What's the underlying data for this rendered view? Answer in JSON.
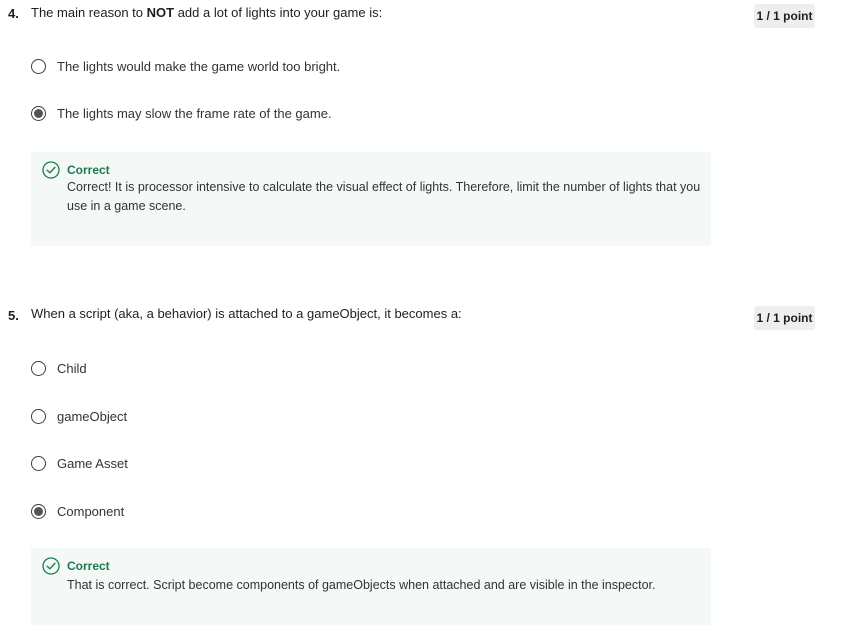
{
  "q4": {
    "number": "4.",
    "text_pre": "The main reason to ",
    "text_bold": "NOT",
    "text_post": " add a lot of lights into your game is:",
    "points": "1 / 1 point",
    "options": [
      {
        "label": "The lights would make the game world too bright.",
        "selected": false
      },
      {
        "label": "The lights may slow the frame rate of the game.",
        "selected": true
      }
    ],
    "feedback": {
      "status": "Correct",
      "text": "Correct! It is processor intensive to calculate the visual effect of lights.  Therefore, limit the number of lights that you use in a game scene."
    }
  },
  "q5": {
    "number": "5.",
    "text": "When a script (aka, a behavior) is attached to a gameObject, it becomes a:",
    "points": "1 / 1 point",
    "options": [
      {
        "label": "Child",
        "selected": false
      },
      {
        "label": "gameObject",
        "selected": false
      },
      {
        "label": "Game Asset",
        "selected": false
      },
      {
        "label": "Component",
        "selected": true
      }
    ],
    "feedback": {
      "status": "Correct",
      "text": "That is correct. Script become components of gameObjects when attached and are visible in the inspector."
    }
  },
  "colors": {
    "correct_green": "#1b7a4e",
    "feedback_bg": "#f4f8f6",
    "points_bg": "#eeeeee"
  },
  "icons": {
    "feedback": "check-circle-icon",
    "option": "radio-button"
  }
}
